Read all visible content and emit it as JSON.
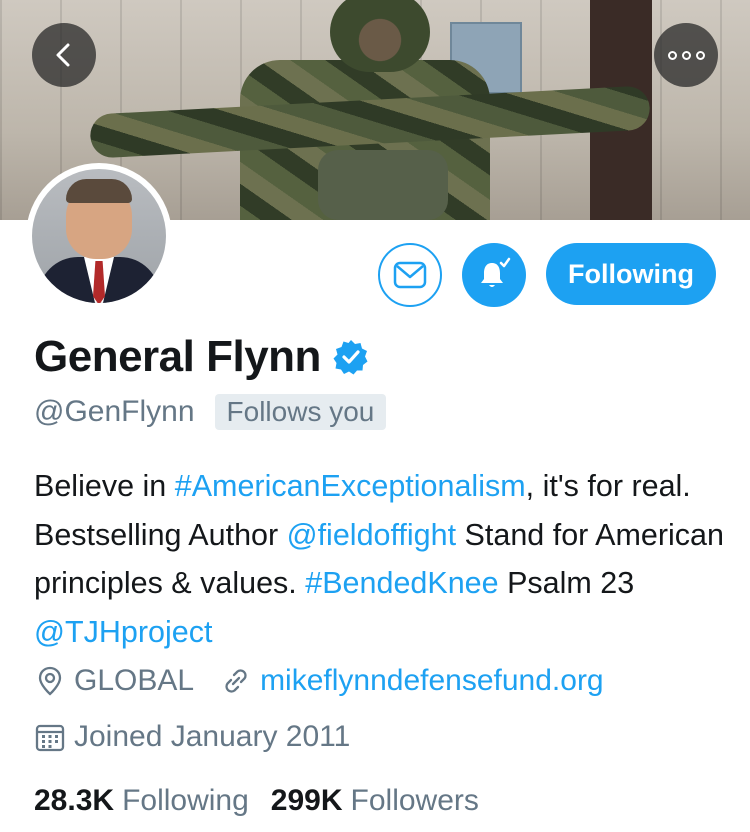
{
  "header": {
    "back_icon": "chevron-left-icon",
    "more_icon": "more-dots-icon"
  },
  "actions": {
    "message_icon": "mail-icon",
    "notifications_icon": "bell-check-icon",
    "follow_label": "Following"
  },
  "profile": {
    "name": "General Flynn",
    "verified_icon": "verified-badge-icon",
    "handle": "@GenFlynn",
    "follows_you": "Follows you",
    "bio": {
      "p1": "Believe in ",
      "tag1": "#AmericanExceptionalism",
      "p2": ", it's for real. Bestselling Author ",
      "mention1": "@fieldoffight",
      "p3": " Stand for American principles & values. ",
      "tag2": "#BendedKnee",
      "p4": " Psalm 23 ",
      "mention2": "@TJHproject"
    },
    "location": "GLOBAL",
    "website": "mikeflynndefensefund.org",
    "joined": "Joined January 2011"
  },
  "stats": {
    "following_count": "28.3K",
    "following_label": "Following",
    "followers_count": "299K",
    "followers_label": "Followers"
  },
  "colors": {
    "accent": "#1da1f2",
    "muted_text": "#657786",
    "text": "#14171a"
  }
}
